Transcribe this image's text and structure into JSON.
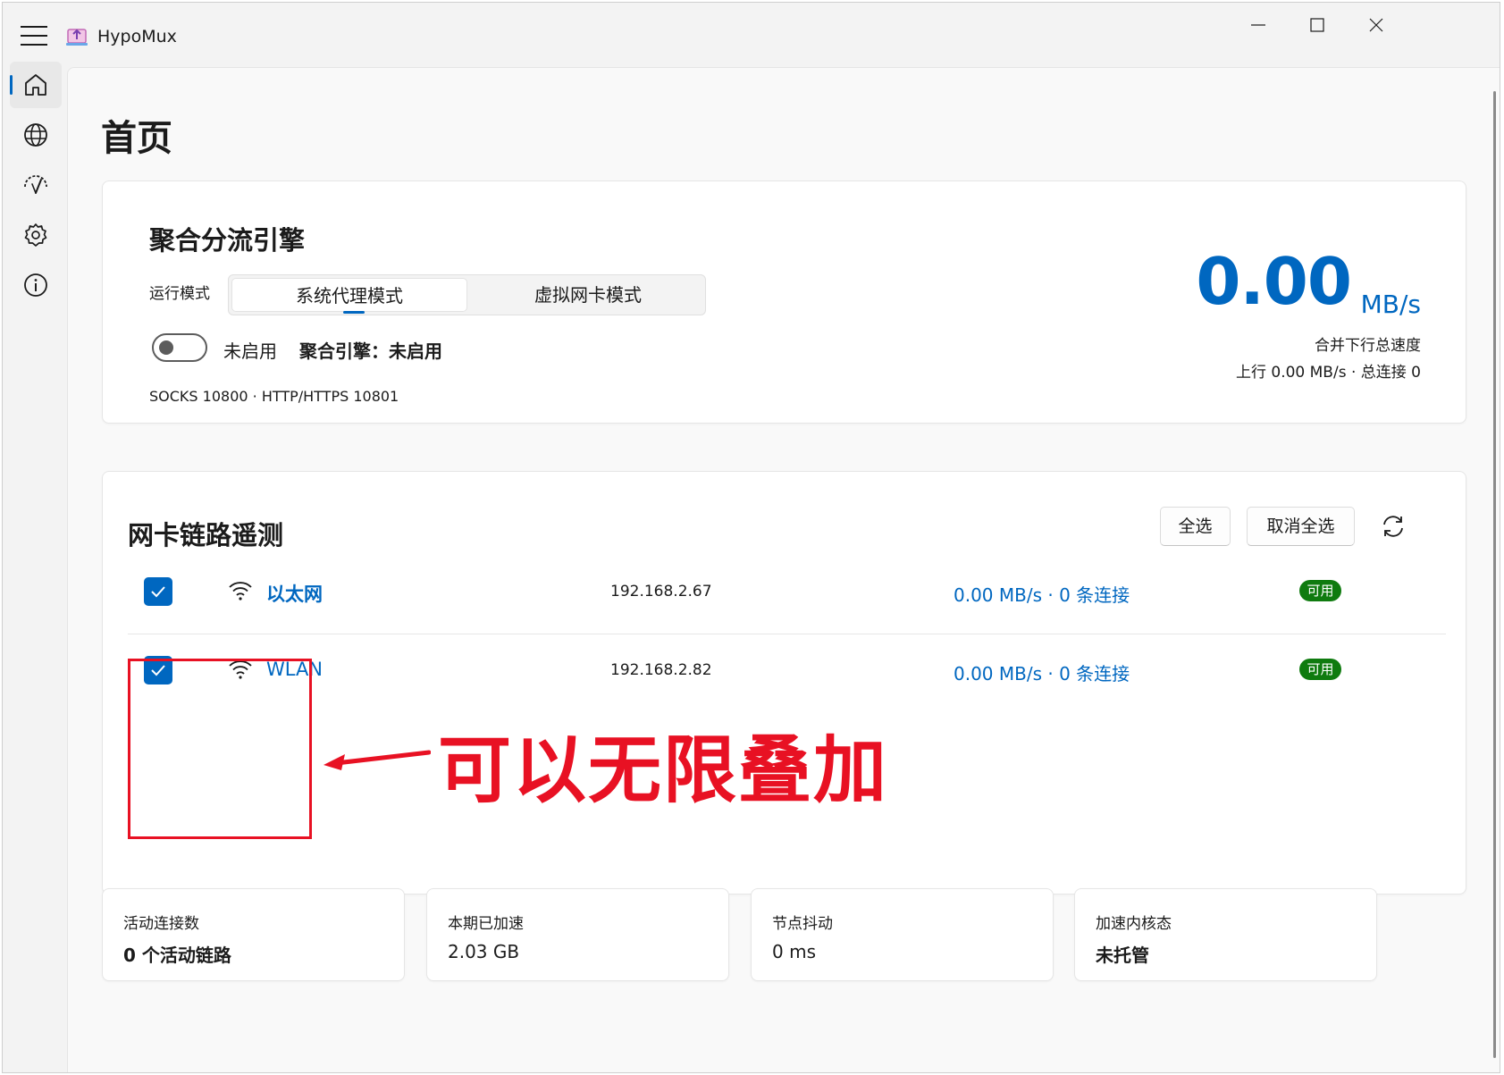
{
  "app": {
    "title": "HypoMux"
  },
  "nav": {
    "items": [
      "home",
      "globe",
      "speed",
      "settings",
      "info"
    ]
  },
  "page": {
    "title": "首页"
  },
  "engine": {
    "title": "聚合分流引擎",
    "mode_label": "运行模式",
    "modes": [
      "系统代理模式",
      "虚拟网卡模式"
    ],
    "selected_mode": "系统代理模式",
    "toggle_on": false,
    "toggle_text": "未启用",
    "status_text": "聚合引擎：未启用",
    "ports": "SOCKS 10800 · HTTP/HTTPS 10801",
    "speed_value": "0.00",
    "speed_unit": "MB/s",
    "speed_caption": "合并下行总速度",
    "speed_detail": "上行 0.00 MB/s · 总连接 0"
  },
  "nic": {
    "title": "网卡链路遥测",
    "select_all": "全选",
    "deselect_all": "取消全选",
    "rows": [
      {
        "name": "以太网",
        "ip": "192.168.2.67",
        "stats": "0.00 MB/s · 0 条连接",
        "badge": "可用",
        "checked": true
      },
      {
        "name": "WLAN",
        "ip": "192.168.2.82",
        "stats": "0.00 MB/s · 0 条连接",
        "badge": "可用",
        "checked": true
      }
    ]
  },
  "annotation": {
    "text": "可以无限叠加",
    "color": "#e81123"
  },
  "stats": [
    {
      "label": "活动连接数",
      "value": "0 个活动链路"
    },
    {
      "label": "本期已加速",
      "value": "2.03 GB"
    },
    {
      "label": "节点抖动",
      "value": "0 ms"
    },
    {
      "label": "加速内核态",
      "value": "未托管"
    }
  ],
  "colors": {
    "accent": "#0067c0",
    "success": "#0f7b0f",
    "annotation": "#e81123"
  }
}
